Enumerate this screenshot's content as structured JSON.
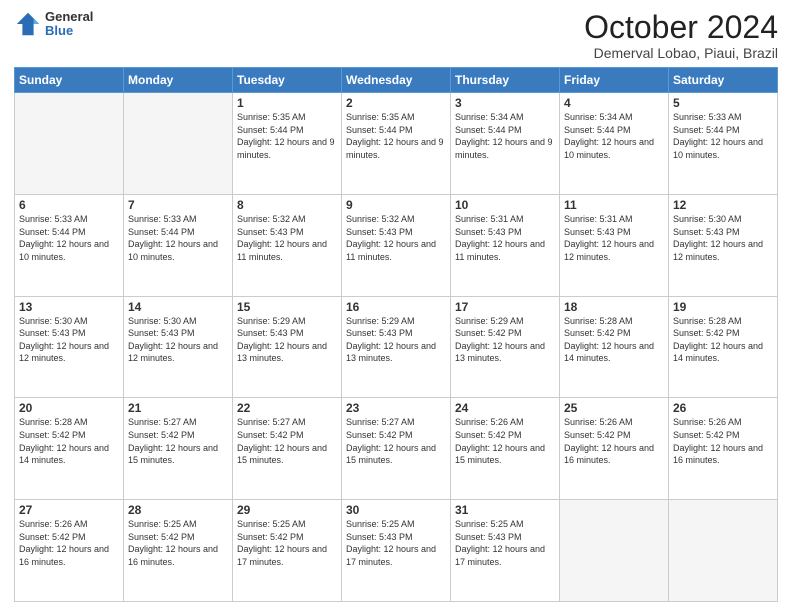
{
  "logo": {
    "general": "General",
    "blue": "Blue"
  },
  "title": "October 2024",
  "location": "Demerval Lobao, Piaui, Brazil",
  "days_header": [
    "Sunday",
    "Monday",
    "Tuesday",
    "Wednesday",
    "Thursday",
    "Friday",
    "Saturday"
  ],
  "weeks": [
    [
      {
        "day": "",
        "info": "",
        "empty": true
      },
      {
        "day": "",
        "info": "",
        "empty": true
      },
      {
        "day": "1",
        "info": "Sunrise: 5:35 AM\nSunset: 5:44 PM\nDaylight: 12 hours and 9 minutes."
      },
      {
        "day": "2",
        "info": "Sunrise: 5:35 AM\nSunset: 5:44 PM\nDaylight: 12 hours and 9 minutes."
      },
      {
        "day": "3",
        "info": "Sunrise: 5:34 AM\nSunset: 5:44 PM\nDaylight: 12 hours and 9 minutes."
      },
      {
        "day": "4",
        "info": "Sunrise: 5:34 AM\nSunset: 5:44 PM\nDaylight: 12 hours and 10 minutes."
      },
      {
        "day": "5",
        "info": "Sunrise: 5:33 AM\nSunset: 5:44 PM\nDaylight: 12 hours and 10 minutes."
      }
    ],
    [
      {
        "day": "6",
        "info": "Sunrise: 5:33 AM\nSunset: 5:44 PM\nDaylight: 12 hours and 10 minutes."
      },
      {
        "day": "7",
        "info": "Sunrise: 5:33 AM\nSunset: 5:44 PM\nDaylight: 12 hours and 10 minutes."
      },
      {
        "day": "8",
        "info": "Sunrise: 5:32 AM\nSunset: 5:43 PM\nDaylight: 12 hours and 11 minutes."
      },
      {
        "day": "9",
        "info": "Sunrise: 5:32 AM\nSunset: 5:43 PM\nDaylight: 12 hours and 11 minutes."
      },
      {
        "day": "10",
        "info": "Sunrise: 5:31 AM\nSunset: 5:43 PM\nDaylight: 12 hours and 11 minutes."
      },
      {
        "day": "11",
        "info": "Sunrise: 5:31 AM\nSunset: 5:43 PM\nDaylight: 12 hours and 12 minutes."
      },
      {
        "day": "12",
        "info": "Sunrise: 5:30 AM\nSunset: 5:43 PM\nDaylight: 12 hours and 12 minutes."
      }
    ],
    [
      {
        "day": "13",
        "info": "Sunrise: 5:30 AM\nSunset: 5:43 PM\nDaylight: 12 hours and 12 minutes."
      },
      {
        "day": "14",
        "info": "Sunrise: 5:30 AM\nSunset: 5:43 PM\nDaylight: 12 hours and 12 minutes."
      },
      {
        "day": "15",
        "info": "Sunrise: 5:29 AM\nSunset: 5:43 PM\nDaylight: 12 hours and 13 minutes."
      },
      {
        "day": "16",
        "info": "Sunrise: 5:29 AM\nSunset: 5:43 PM\nDaylight: 12 hours and 13 minutes."
      },
      {
        "day": "17",
        "info": "Sunrise: 5:29 AM\nSunset: 5:42 PM\nDaylight: 12 hours and 13 minutes."
      },
      {
        "day": "18",
        "info": "Sunrise: 5:28 AM\nSunset: 5:42 PM\nDaylight: 12 hours and 14 minutes."
      },
      {
        "day": "19",
        "info": "Sunrise: 5:28 AM\nSunset: 5:42 PM\nDaylight: 12 hours and 14 minutes."
      }
    ],
    [
      {
        "day": "20",
        "info": "Sunrise: 5:28 AM\nSunset: 5:42 PM\nDaylight: 12 hours and 14 minutes."
      },
      {
        "day": "21",
        "info": "Sunrise: 5:27 AM\nSunset: 5:42 PM\nDaylight: 12 hours and 15 minutes."
      },
      {
        "day": "22",
        "info": "Sunrise: 5:27 AM\nSunset: 5:42 PM\nDaylight: 12 hours and 15 minutes."
      },
      {
        "day": "23",
        "info": "Sunrise: 5:27 AM\nSunset: 5:42 PM\nDaylight: 12 hours and 15 minutes."
      },
      {
        "day": "24",
        "info": "Sunrise: 5:26 AM\nSunset: 5:42 PM\nDaylight: 12 hours and 15 minutes."
      },
      {
        "day": "25",
        "info": "Sunrise: 5:26 AM\nSunset: 5:42 PM\nDaylight: 12 hours and 16 minutes."
      },
      {
        "day": "26",
        "info": "Sunrise: 5:26 AM\nSunset: 5:42 PM\nDaylight: 12 hours and 16 minutes."
      }
    ],
    [
      {
        "day": "27",
        "info": "Sunrise: 5:26 AM\nSunset: 5:42 PM\nDaylight: 12 hours and 16 minutes."
      },
      {
        "day": "28",
        "info": "Sunrise: 5:25 AM\nSunset: 5:42 PM\nDaylight: 12 hours and 16 minutes."
      },
      {
        "day": "29",
        "info": "Sunrise: 5:25 AM\nSunset: 5:42 PM\nDaylight: 12 hours and 17 minutes."
      },
      {
        "day": "30",
        "info": "Sunrise: 5:25 AM\nSunset: 5:43 PM\nDaylight: 12 hours and 17 minutes."
      },
      {
        "day": "31",
        "info": "Sunrise: 5:25 AM\nSunset: 5:43 PM\nDaylight: 12 hours and 17 minutes."
      },
      {
        "day": "",
        "info": "",
        "empty": true
      },
      {
        "day": "",
        "info": "",
        "empty": true
      }
    ]
  ]
}
